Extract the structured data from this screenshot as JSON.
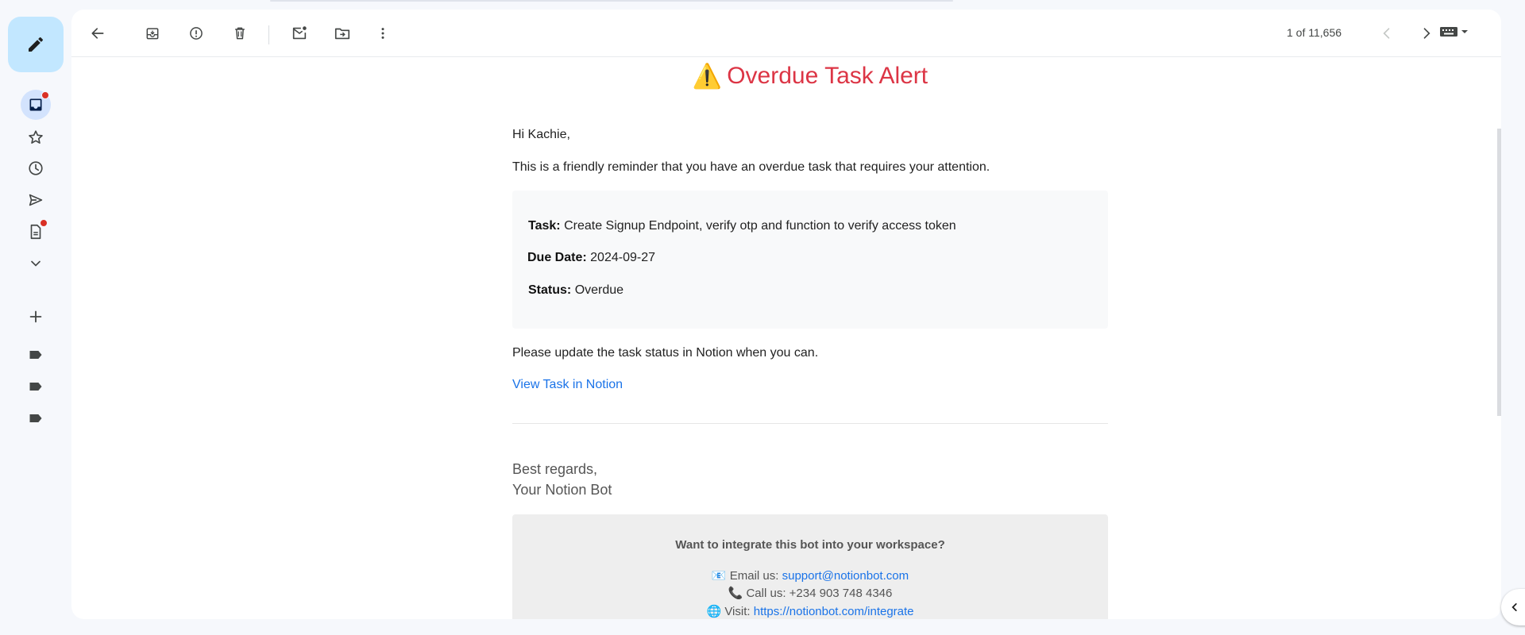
{
  "toolbar": {
    "pager_text": "1 of 11,656"
  },
  "email": {
    "title_emoji": "⚠️",
    "title": "Overdue Task Alert",
    "greeting": "Hi Kachie,",
    "intro": "This is a friendly reminder that you have an overdue task that requires your attention.",
    "task_label": "Task:",
    "task_value": "Create Signup Endpoint, verify otp and function to verify access token",
    "due_label": "Due Date:",
    "due_value": "2024-09-27",
    "status_label": "Status:",
    "status_value": "Overdue",
    "update_text": "Please update the task status in Notion when you can.",
    "view_link": "View Task in Notion",
    "regards": "Best regards,",
    "sender": "Your Notion Bot",
    "footer": {
      "question": "Want to integrate this bot into your workspace?",
      "email_emoji": "📧",
      "email_label": "Email us:",
      "email_value": "support@notionbot.com",
      "phone_emoji": "📞",
      "phone_text": "Call us: +234 903 748 4346",
      "visit_emoji": "🌐",
      "visit_label": "Visit:",
      "visit_value": "https://notionbot.com/integrate"
    }
  },
  "colors": {
    "accent": "#c2e7ff",
    "alert_red": "#dc3545",
    "link_blue": "#1a73e8",
    "badge_red": "#d93025"
  },
  "icons": {
    "rail": [
      "pencil-icon",
      "inbox-icon",
      "star-icon",
      "clock-icon",
      "send-icon",
      "draft-icon",
      "chevron-down-icon",
      "plus-icon",
      "label-icon",
      "label-icon",
      "label-icon"
    ],
    "toolbar": [
      "back-arrow-icon",
      "archive-icon",
      "report-spam-icon",
      "delete-icon",
      "mark-unread-icon",
      "move-to-icon",
      "more-vert-icon",
      "chevron-left-icon",
      "chevron-right-icon",
      "keyboard-icon"
    ]
  }
}
